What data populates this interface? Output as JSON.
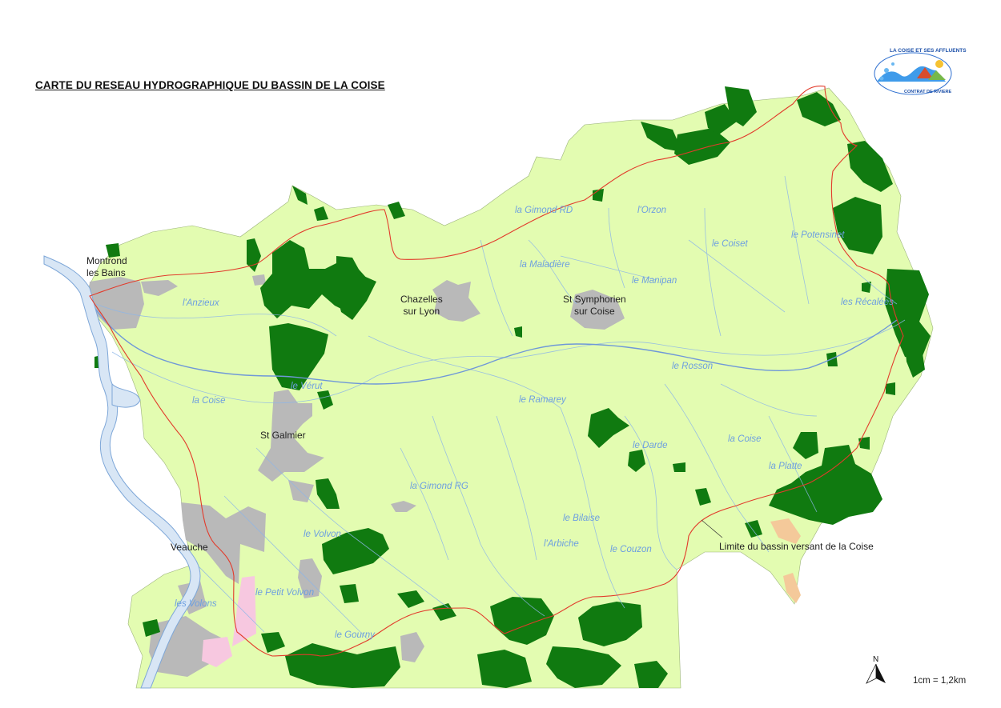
{
  "map": {
    "title": "CARTE DU RESEAU HYDROGRAPHIQUE DU BASSIN DE LA COISE",
    "boundary_label": "Limite du bassin versant de la Coise",
    "scale": "1cm = 1,2km",
    "north_label": "N",
    "logo": {
      "top_text": "LA COISE ET SES AFFLUENTS",
      "bottom_text": "CONTRAT DE RIVIERE"
    },
    "colors": {
      "basin_fill": "#e3fcb1",
      "forest": "#107a10",
      "urban": "#b9b9b9",
      "boundary_line": "#e23b2b",
      "river": "#8db6e8",
      "main_river": "#6f98d8",
      "pink_zone": "#f7c8e0"
    },
    "towns": [
      {
        "line1": "Montrond",
        "line2": "les Bains"
      },
      {
        "line1": "Chazelles",
        "line2": "sur Lyon"
      },
      {
        "line1": "St Symphorien",
        "line2": "sur Coise"
      },
      {
        "line1": "St Galmier",
        "line2": ""
      },
      {
        "line1": "Veauche",
        "line2": ""
      }
    ],
    "rivers": [
      "la Gimond RD",
      "l'Orzon",
      "le Coiset",
      "le Potensinet",
      "la Maladière",
      "le Manipan",
      "les Récalées",
      "l'Anzieux",
      "le Rosson",
      "le Vérut",
      "la Coise",
      "le Ramarey",
      "le Darde",
      "la Coise",
      "la Platte",
      "la Gimond RG",
      "le Bilaise",
      "le Volvon",
      "l'Arbiche",
      "le Couzon",
      "le Petit Volvon",
      "les Volons",
      "le Gourny"
    ]
  }
}
